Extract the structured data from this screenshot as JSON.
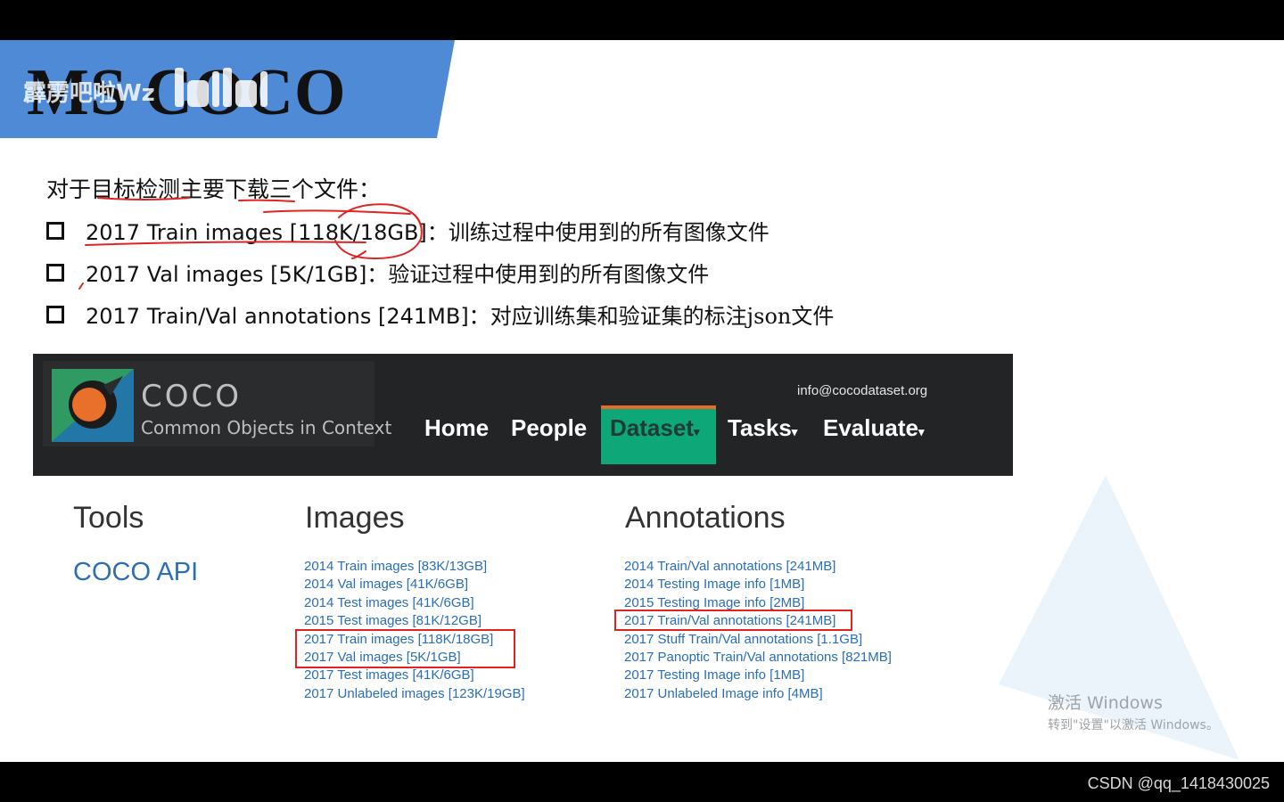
{
  "colors": {
    "banner_blue": "#4f8ad6",
    "coco_green": "#0ea777",
    "coco_orange": "#e66c2c",
    "link_blue": "#2a6eb8",
    "annotation_red": "#e02424"
  },
  "slide": {
    "title": "MS COCO",
    "overlay_text": "霹雳吧啦Wz",
    "intro": "对于目标检测主要下载三个文件：",
    "bullets": [
      {
        "text": "2017 Train images [118K/18GB]：",
        "desc": "训练过程中使用到的所有图像文件"
      },
      {
        "text": "2017 Val images [5K/1GB]：",
        "desc": "验证过程中使用到的所有图像文件"
      },
      {
        "text": "2017 Train/Val annotations [241MB]：",
        "desc": "对应训练集和验证集的标注json文件"
      }
    ]
  },
  "coco": {
    "logo_title": "COCO",
    "logo_subtitle": "Common Objects in Context",
    "email": "info@cocodataset.org",
    "nav": [
      {
        "label": "Home"
      },
      {
        "label": "People"
      },
      {
        "label": "Dataset",
        "caret": "▾"
      },
      {
        "label": "Tasks",
        "caret": "▾"
      },
      {
        "label": "Evaluate",
        "caret": "▾"
      }
    ],
    "tools_title": "Tools",
    "tools_link": "COCO API",
    "images_title": "Images",
    "images_links": [
      "2014 Train images [83K/13GB]",
      "2014 Val images [41K/6GB]",
      "2014 Test images [41K/6GB]",
      "2015 Test images [81K/12GB]",
      "2017 Train images [118K/18GB]",
      "2017 Val images [5K/1GB]",
      "2017 Test images [41K/6GB]",
      "2017 Unlabeled images [123K/19GB]"
    ],
    "annotations_title": "Annotations",
    "annotations_links": [
      "2014 Train/Val annotations [241MB]",
      "2014 Testing Image info [1MB]",
      "2015 Testing Image info [2MB]",
      "2017 Train/Val annotations [241MB]",
      "2017 Stuff Train/Val annotations [1.1GB]",
      "2017 Panoptic Train/Val annotations [821MB]",
      "2017 Testing Image info [1MB]",
      "2017 Unlabeled Image info [4MB]"
    ]
  },
  "windows_watermark": {
    "line1": "激活 Windows",
    "line2": "转到\"设置\"以激活 Windows。"
  },
  "footer": "CSDN @qq_1418430025"
}
